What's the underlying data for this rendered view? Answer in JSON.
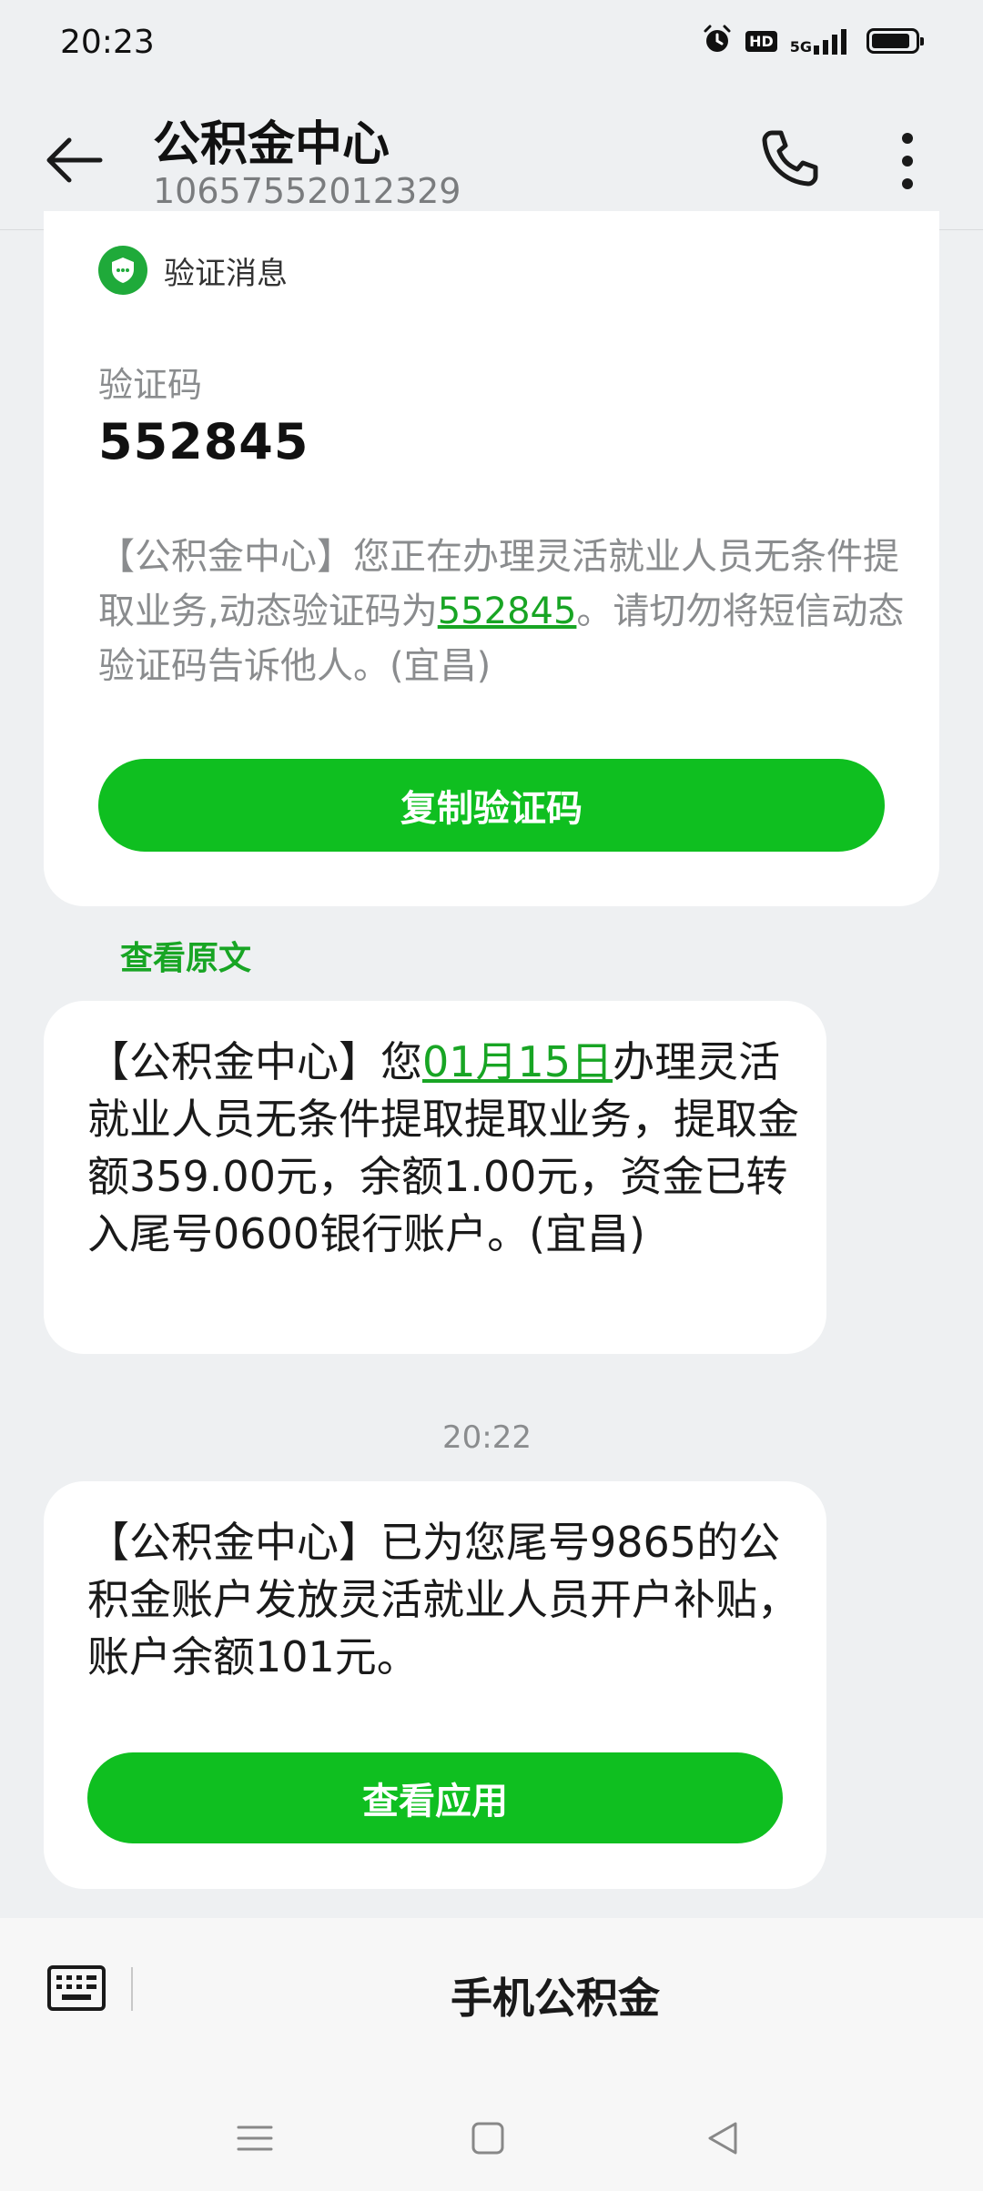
{
  "status_bar": {
    "time": "20:23",
    "hd": "HD",
    "network": "5G",
    "icons": [
      "alarm-icon",
      "hd-icon",
      "signal-icon",
      "battery-icon"
    ],
    "battery_level": 0.9
  },
  "header": {
    "title": "公积金中心",
    "subtitle": "10657552012329",
    "icons": [
      "back-arrow-icon",
      "phone-icon",
      "more-vert-icon"
    ]
  },
  "otp_card": {
    "badge_label": "验证消息",
    "code_caption": "验证码",
    "code_value": "552845",
    "text_before": "【公积金中心】您正在办理灵活就业人员无条件提取业务,动态验证码为",
    "text_link": "552845",
    "text_after": "。请切勿将短信动态验证码告诉他人。(宜昌)",
    "copy_button": "复制验证码"
  },
  "view_original": "查看原文",
  "message1": {
    "text_before": "【公积金中心】您",
    "link": "01月15日",
    "text_after": "办理灵活就业人员无条件提取提取业务，提取金额359.00元，余额1.00元，资金已转入尾号0600银行账户。(宜昌)"
  },
  "time_divider": "20:22",
  "message2": {
    "text": "【公积金中心】已为您尾号9865的公积金账户发放灵活就业人员开户补贴，账户余额101元。",
    "button": "查看应用"
  },
  "input_bar": {
    "menu_label": "手机公积金",
    "icons": [
      "keyboard-icon"
    ]
  },
  "nav_bar": {
    "icons": [
      "menu-icon",
      "home-icon",
      "back-icon"
    ]
  },
  "colors": {
    "accent_green": "#0fbf20",
    "link_green": "#18a524",
    "background": "#eef0f2"
  }
}
